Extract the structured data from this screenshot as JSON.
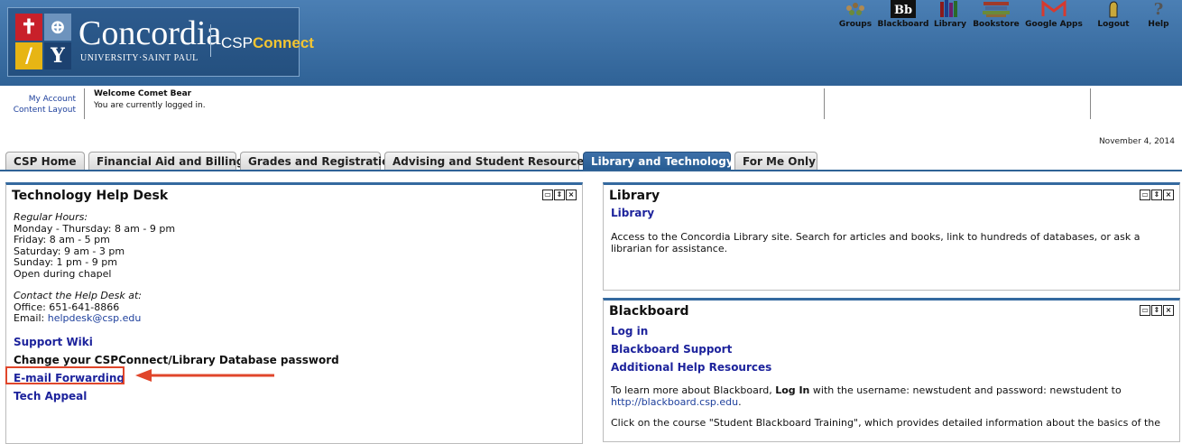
{
  "brand": {
    "name": "Concordia",
    "subtitle": "UNIVERSITY·SAINT PAUL",
    "portal_prefix": "CSP",
    "portal_suffix": "Connect"
  },
  "account": {
    "my_account": "My Account",
    "content_layout": "Content Layout",
    "welcome": "Welcome Comet Bear",
    "status": "You are currently logged in."
  },
  "toolbar": [
    {
      "label": "Groups",
      "icon": "groups-icon"
    },
    {
      "label": "Blackboard",
      "icon": "blackboard-icon"
    },
    {
      "label": "Library",
      "icon": "library-icon"
    },
    {
      "label": "Bookstore",
      "icon": "bookstore-icon"
    },
    {
      "label": "Google Apps",
      "icon": "gmail-icon"
    },
    {
      "label": "Logout",
      "icon": "logout-icon"
    },
    {
      "label": "Help",
      "icon": "help-icon"
    }
  ],
  "date": "November 4, 2014",
  "tabs": [
    {
      "label": "CSP Home"
    },
    {
      "label": "Financial Aid and Billing"
    },
    {
      "label": "Grades and Registration"
    },
    {
      "label": "Advising and Student Resources"
    },
    {
      "label": "Library and Technology",
      "active": true
    },
    {
      "label": "For Me Only"
    }
  ],
  "helpdesk": {
    "title": "Technology Help Desk",
    "hours_heading": "Regular Hours:",
    "hours": [
      "Monday - Thursday: 8 am - 9 pm",
      "Friday: 8 am - 5 pm",
      "Saturday: 9 am - 3 pm",
      "Sunday: 1 pm - 9 pm",
      "Open during chapel"
    ],
    "contact_heading": "Contact the Help Desk at:",
    "office": "Office: 651-641-8866",
    "email_prefix": "Email: ",
    "email": "helpdesk@csp.edu",
    "links": [
      "Support Wiki",
      "Change your CSPConnect/Library Database password",
      "E-mail Forwarding",
      "Tech Appeal"
    ]
  },
  "library": {
    "title": "Library",
    "link": "Library",
    "desc_line1": "Access to the Concordia Library site.  Search for articles and books, link to hundreds of databases, or ask a",
    "desc_line2": "librarian for assistance."
  },
  "blackboard": {
    "title": "Blackboard",
    "links": [
      "Log in",
      "Blackboard Support",
      "Additional Help Resources"
    ],
    "text1_a": "To learn more about Blackboard, ",
    "text1_b": "Log In",
    "text1_c": " with the username: newstudent and password: newstudent to",
    "text1_url": "http://blackboard.csp.edu",
    "text1_end": ".",
    "text2": "Click on the course \"Student Blackboard Training\", which provides detailed information about the basics of the"
  },
  "colors": {
    "banner": "#2f6296",
    "accent_gold": "#f3c531",
    "link": "#1d239c",
    "annotation": "#e0462b"
  }
}
